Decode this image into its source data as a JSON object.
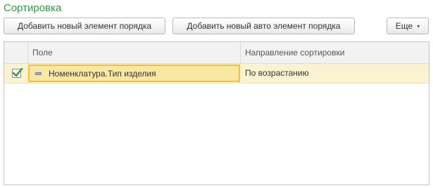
{
  "section": {
    "title": "Сортировка"
  },
  "toolbar": {
    "add_label": "Добавить новый элемент порядка",
    "add_auto_label": "Добавить новый авто элемент порядка",
    "more_label": "Еще",
    "more_arrow": "▾"
  },
  "grid": {
    "columns": {
      "field": "Поле",
      "direction": "Направление сортировки"
    },
    "rows": [
      {
        "checked": true,
        "field": "Номенклатура.Тип изделия",
        "direction": "По возрастанию"
      }
    ]
  },
  "colors": {
    "title": "#2a9c3a",
    "selected_row": "#fbf3d0",
    "active_cell": "#f9e7a4",
    "active_cell_border": "#f0c23a",
    "check": "#2e9a3e"
  },
  "icons": {
    "checkbox": "check-icon",
    "field": "field-icon",
    "dropdown": "chevron-down-icon"
  }
}
